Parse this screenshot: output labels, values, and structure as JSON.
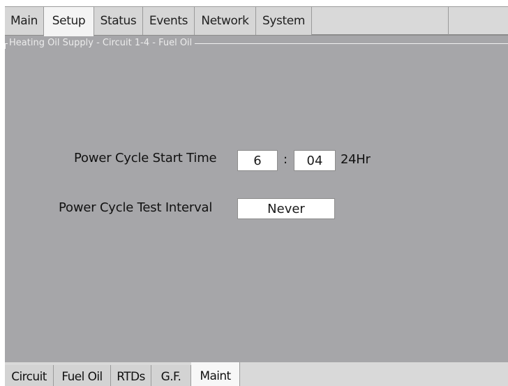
{
  "top_tabs": [
    {
      "label": "Main",
      "active": false
    },
    {
      "label": "Setup",
      "active": true
    },
    {
      "label": "Status",
      "active": false
    },
    {
      "label": "Events",
      "active": false
    },
    {
      "label": "Network",
      "active": false
    },
    {
      "label": "System",
      "active": false
    }
  ],
  "panel": {
    "title": "Heating Oil Supply - Circuit 1-4 - Fuel Oil",
    "start_time": {
      "label": "Power Cycle Start Time",
      "hour": "6",
      "separator": ":",
      "minute": "04",
      "unit": "24Hr"
    },
    "test_interval": {
      "label": "Power Cycle Test Interval",
      "value": "Never"
    }
  },
  "bottom_tabs": [
    {
      "label": "Circuit",
      "active": false
    },
    {
      "label": "Fuel Oil",
      "active": false
    },
    {
      "label": "RTDs",
      "active": false
    },
    {
      "label": "G.F.",
      "active": false
    },
    {
      "label": "Maint",
      "active": true
    }
  ],
  "colors": {
    "panel_background": "#a6a6a9",
    "tab_bar_background": "#d9d9d9",
    "active_tab_background": "#f4f4f4"
  }
}
